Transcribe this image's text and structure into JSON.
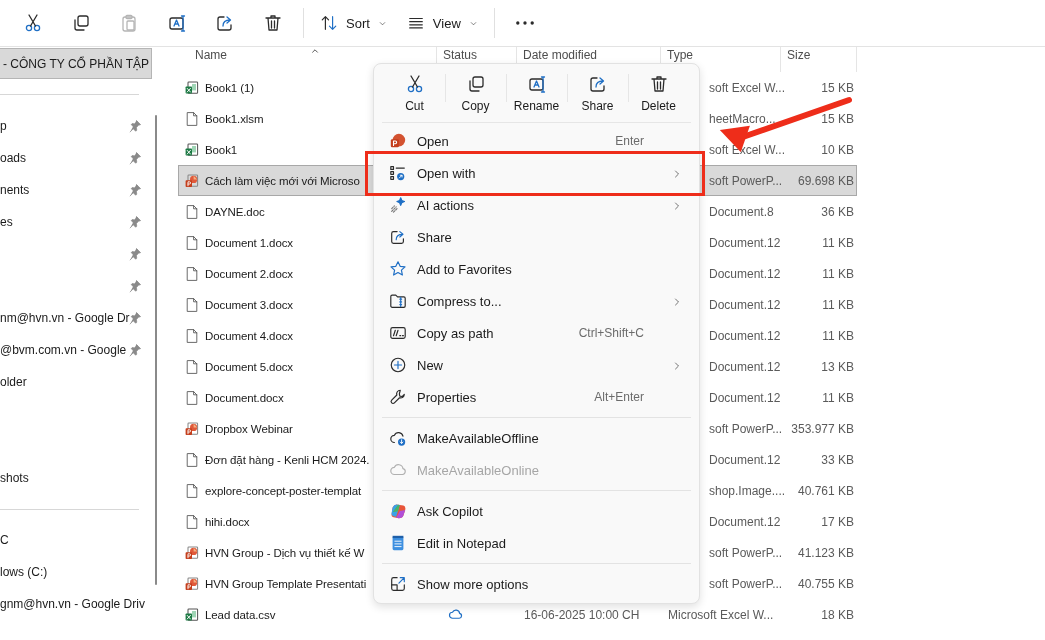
{
  "toolbar": {
    "buttons": [
      {
        "disabled": false
      },
      {
        "disabled": false
      },
      {
        "disabled": true
      },
      {
        "disabled": false
      },
      {
        "disabled": false
      },
      {
        "disabled": false
      }
    ],
    "sort": {
      "label": "Sort"
    },
    "view": {
      "label": "View"
    }
  },
  "nav": {
    "header": {
      "label": "- CÔNG TY CỔ PHẦN TẬP",
      "selected": true
    },
    "groups": [
      {
        "items": [
          {
            "label": "p",
            "pinned": true
          },
          {
            "label": "oads",
            "pinned": true
          },
          {
            "label": "nents",
            "pinned": true
          },
          {
            "label": "es",
            "pinned": true
          },
          {
            "pinned": true
          },
          {
            "pinned": true
          },
          {
            "label": "nm@hvn.vn - Google Dr",
            "pinned": true
          },
          {
            "label": "@bvm.com.vn - Google",
            "pinned": true
          },
          {
            "label": "older",
            "pinned": false
          },
          {
            "pinned": false
          },
          {
            "pinned": false
          },
          {
            "label": "shots",
            "pinned": false
          }
        ]
      },
      {
        "items": [
          {
            "label": "C",
            "pinned": false
          },
          {
            "label": "lows (C:)",
            "pinned": false
          },
          {
            "label": "gnm@hvn.vn - Google Driv",
            "pinned": false
          }
        ]
      }
    ]
  },
  "files": {
    "columns": [
      "Name",
      "Status",
      "Date modified",
      "Type",
      "Size"
    ],
    "rows": [
      {
        "kind": "excel",
        "name": "Book1 (1)",
        "type": "soft Excel W...",
        "size": "15 KB",
        "selected": false
      },
      {
        "kind": "blank",
        "name": "Book1.xlsm",
        "type": "heetMacro...",
        "size": "15 KB",
        "selected": false
      },
      {
        "kind": "excel",
        "name": "Book1",
        "type": "soft Excel W...",
        "size": "10 KB",
        "selected": false
      },
      {
        "kind": "powerpoint",
        "name": "Cách làm việc mới với Microso",
        "type": "soft PowerP...",
        "size": "69.698 KB",
        "selected": true
      },
      {
        "kind": "blank",
        "name": "DAYNE.doc",
        "type": "Document.8",
        "size": "36 KB",
        "selected": false
      },
      {
        "kind": "blank",
        "name": "Document 1.docx",
        "type": "Document.12",
        "size": "11 KB",
        "selected": false
      },
      {
        "kind": "blank",
        "name": "Document 2.docx",
        "type": "Document.12",
        "size": "11 KB",
        "selected": false
      },
      {
        "kind": "blank",
        "name": "Document 3.docx",
        "type": "Document.12",
        "size": "11 KB",
        "selected": false
      },
      {
        "kind": "blank",
        "name": "Document 4.docx",
        "type": "Document.12",
        "size": "11 KB",
        "selected": false
      },
      {
        "kind": "blank",
        "name": "Document 5.docx",
        "type": "Document.12",
        "size": "13 KB",
        "selected": false
      },
      {
        "kind": "blank",
        "name": "Document.docx",
        "type": "Document.12",
        "size": "11 KB",
        "selected": false
      },
      {
        "kind": "powerpoint",
        "name": "Dropbox Webinar",
        "type": "soft PowerP...",
        "size": "353.977 KB",
        "selected": false
      },
      {
        "kind": "blank",
        "name": "Đơn đặt hàng - Kenli HCM 2024.",
        "type": "Document.12",
        "size": "33 KB",
        "selected": false
      },
      {
        "kind": "blank",
        "name": "explore-concept-poster-templat",
        "type": "shop.Image....",
        "size": "40.761 KB",
        "selected": false
      },
      {
        "kind": "blank",
        "name": "hihi.docx",
        "type": "Document.12",
        "size": "17 KB",
        "selected": false
      },
      {
        "kind": "powerpoint",
        "name": "HVN Group - Dịch vụ thiết kế W",
        "type": "soft PowerP...",
        "size": "41.123 KB",
        "selected": false
      },
      {
        "kind": "powerpoint",
        "name": "HVN Group Template Presentati",
        "type": "soft PowerP...",
        "size": "40.755 KB",
        "selected": false
      },
      {
        "kind": "excel",
        "name": "Lead data.csv",
        "status": {
          "kind": "cloud"
        },
        "date": "16-06-2025 10:00 CH",
        "type": "Microsoft Excel W...",
        "size": "18 KB",
        "selected": false
      }
    ]
  },
  "context_menu": {
    "actions": [
      "Cut",
      "Copy",
      "Rename",
      "Share",
      "Delete"
    ],
    "items": [
      {
        "kind": "item",
        "label": "Open",
        "shortcut": "Enter",
        "submenu": false,
        "disabled": false,
        "highlighted": false
      },
      {
        "kind": "item",
        "label": "Open with",
        "submenu": true,
        "disabled": false,
        "highlighted": true
      },
      {
        "kind": "item",
        "label": "AI actions",
        "submenu": true,
        "disabled": false,
        "highlighted": false
      },
      {
        "kind": "item",
        "label": "Share",
        "submenu": false,
        "disabled": false,
        "highlighted": false
      },
      {
        "kind": "item",
        "label": "Add to Favorites",
        "submenu": false,
        "disabled": false,
        "highlighted": false
      },
      {
        "kind": "item",
        "label": "Compress to...",
        "submenu": true,
        "disabled": false,
        "highlighted": false
      },
      {
        "kind": "item",
        "label": "Copy as path",
        "shortcut": "Ctrl+Shift+C",
        "submenu": false,
        "disabled": false,
        "highlighted": false
      },
      {
        "kind": "item",
        "label": "New",
        "submenu": true,
        "disabled": false,
        "highlighted": false
      },
      {
        "kind": "item",
        "label": "Properties",
        "shortcut": "Alt+Enter",
        "submenu": false,
        "disabled": false,
        "highlighted": false
      },
      {
        "kind": "separator"
      },
      {
        "kind": "item",
        "label": "MakeAvailableOffline",
        "submenu": false,
        "disabled": false,
        "highlighted": false
      },
      {
        "kind": "item",
        "label": "MakeAvailableOnline",
        "submenu": false,
        "disabled": true,
        "highlighted": false
      },
      {
        "kind": "separator"
      },
      {
        "kind": "item",
        "label": "Ask Copilot",
        "submenu": false,
        "disabled": false,
        "highlighted": false
      },
      {
        "kind": "item",
        "label": "Edit in Notepad",
        "submenu": false,
        "disabled": false,
        "highlighted": false
      },
      {
        "kind": "separator"
      },
      {
        "kind": "item",
        "label": "Show more options",
        "submenu": false,
        "disabled": false,
        "highlighted": false
      }
    ]
  }
}
